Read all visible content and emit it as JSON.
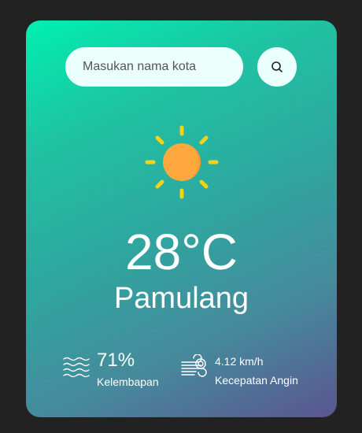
{
  "search": {
    "placeholder": "Masukan nama kota",
    "value": ""
  },
  "icons": {
    "search_button": "search-icon",
    "weather": "sun-icon",
    "humidity": "waves-icon",
    "wind": "wind-icon"
  },
  "weather": {
    "temperature": "28°C",
    "city": "Pamulang"
  },
  "details": {
    "humidity": {
      "value": "71%",
      "label": "Kelembapan"
    },
    "wind": {
      "value": "4.12 km/h",
      "label": "Kecepatan Angin"
    }
  },
  "colors": {
    "background": "#222222",
    "gradient_start": "#00f0b0",
    "gradient_end": "#5b5590",
    "input_background": "#ebfffc",
    "sun_core": "#ffa83d",
    "sun_rays": "#f5d215",
    "text": "#ffffff"
  }
}
